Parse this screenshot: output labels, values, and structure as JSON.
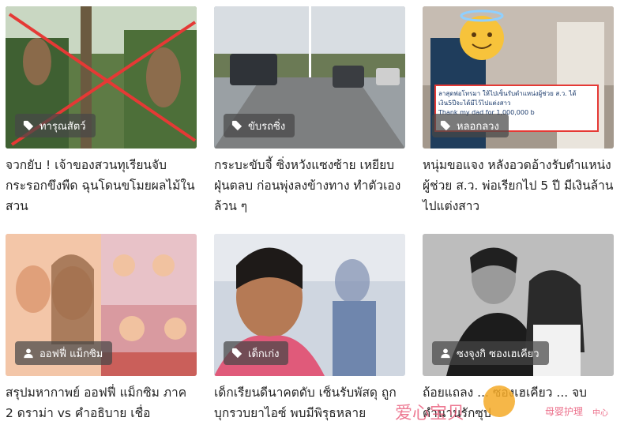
{
  "cards": [
    {
      "tag": "ทารุณสัตว์",
      "tag_icon": "tag-icon",
      "title": "จวกยับ ! เจ้าของสวนทุเรียนจับกระรอกขึงพืด ฉุนโดนขโมยผลไม้ในสวน"
    },
    {
      "tag": "ขับรถซิ่ง",
      "tag_icon": "tag-icon",
      "title": "กระบะขับจี้ ซิ่งหวังแซงซ้าย เหยียบฝุ่นตลบ ก่อนพุ่งลงข้างทาง ทำตัวเองล้วน ๆ"
    },
    {
      "tag": "หลอกลวง",
      "tag_icon": "tag-icon",
      "title": "หนุ่มขอแจง หลังอวดอ้างรับตำแหน่งผู้ช่วย ส.ว. พ่อเรียกไป 5 ปี มีเงินล้านไปแต่งสาว",
      "overlay_text": [
        "ลาสุดพ่อโทรมา ให้ไปเซ็นรับตำแหน่งผู้ช่วย ส.ว. ได้",
        "เงิน5ปีจะได้มีไว้ไปแต่งสาว",
        "Thank my dad for 1,000,000 b"
      ]
    },
    {
      "tag": "ออฟฟี่ แม็กซิม",
      "tag_icon": "person-icon",
      "title": "สรุปมหากาพย์ ออฟฟี่ แม็กซิม ภาค 2 ดราม่า vs คำอธิบาย เชื่อ"
    },
    {
      "tag": "เด็กเก่ง",
      "tag_icon": "tag-icon",
      "title": "เด็กเรียนดีนาคตดับ เซ็นรับพัสดุ ถูกบุกรวบยาไอซ์ พบมีพิรุธหลาย"
    },
    {
      "tag": "ซงจุงกิ ซองเฮเคียว",
      "tag_icon": "person-icon",
      "title": "ถ้อยแถลง ... ซองเฮเคียว ... จบตำนานรักซุป"
    }
  ],
  "watermark": {
    "text": "爱心宝贝",
    "text2": "母婴护理",
    "text3": "中心"
  }
}
